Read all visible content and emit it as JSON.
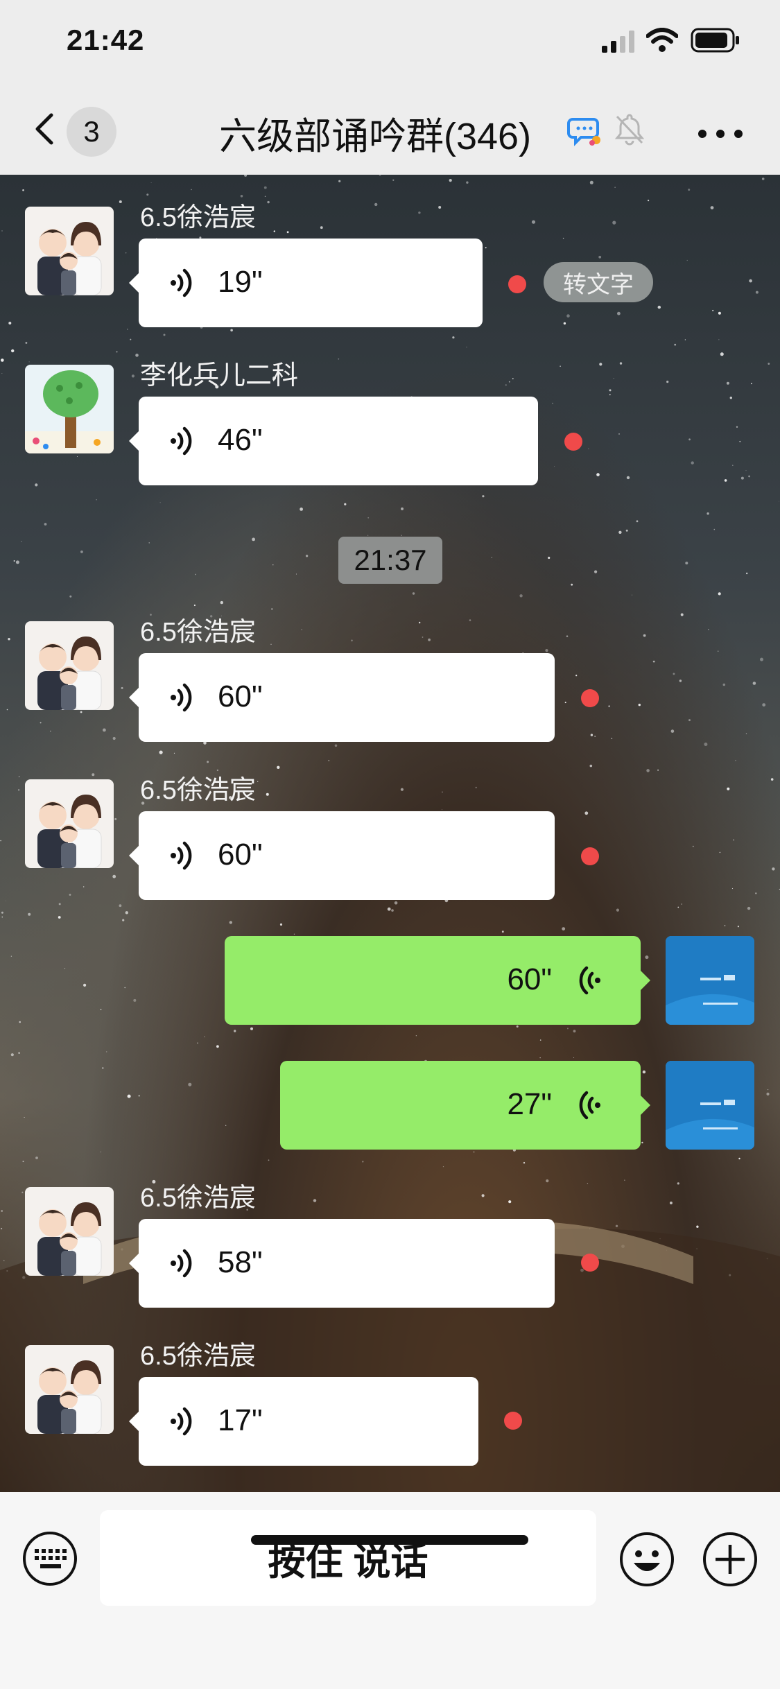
{
  "status_bar": {
    "time": "21:42",
    "icons": [
      "signal-icon",
      "wifi-icon",
      "battery-icon"
    ]
  },
  "nav": {
    "back_count": "3",
    "title": "六级部诵吟群(346)",
    "icons": [
      "back-chevron-icon",
      "chat-group-icon",
      "mute-bell-icon",
      "more-icon"
    ]
  },
  "messages": [
    {
      "sender": "6.5徐浩宸",
      "duration": "19\"",
      "direction": "in",
      "unread": true,
      "action": "转文字"
    },
    {
      "sender": "李化兵儿二科",
      "duration": "46\"",
      "direction": "in",
      "unread": true
    },
    {
      "timestamp": "21:37"
    },
    {
      "sender": "6.5徐浩宸",
      "duration": "60\"",
      "direction": "in",
      "unread": true
    },
    {
      "sender": "6.5徐浩宸",
      "duration": "60\"",
      "direction": "in",
      "unread": true
    },
    {
      "duration": "60\"",
      "direction": "out"
    },
    {
      "duration": "27\"",
      "direction": "out"
    },
    {
      "sender": "6.5徐浩宸",
      "duration": "58\"",
      "direction": "in",
      "unread": true
    },
    {
      "sender": "6.5徐浩宸",
      "duration": "17\"",
      "direction": "in",
      "unread": true
    }
  ],
  "input_bar": {
    "hold_to_talk": "按住 说话",
    "icons": [
      "keyboard-icon",
      "emoji-icon",
      "plus-icon"
    ]
  },
  "colors": {
    "incoming_bubble": "#ffffff",
    "outgoing_bubble": "#95ec69",
    "unread_dot": "#f04a4a",
    "bar_background": "#ededed"
  }
}
